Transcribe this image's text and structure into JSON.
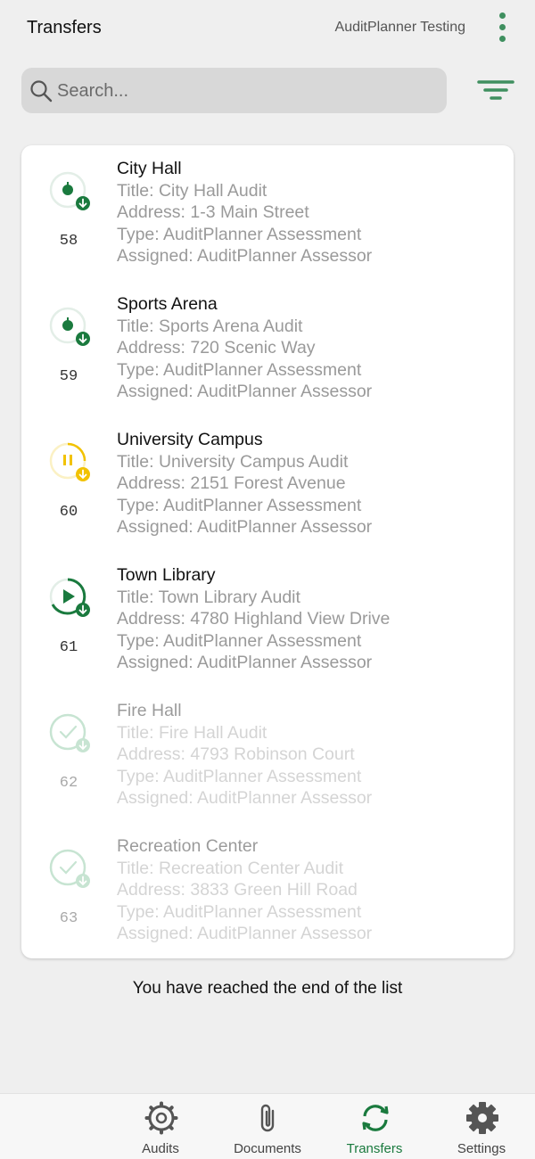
{
  "header": {
    "title": "Transfers",
    "account": "AuditPlanner Testing",
    "menu_icon": "more-vert-icon"
  },
  "search": {
    "placeholder": "Search...",
    "value": "",
    "icon": "search-icon"
  },
  "filter": {
    "icon": "filter-icon"
  },
  "colors": {
    "accent": "#1a7a3e",
    "paused": "#f2c200",
    "completed": "#9fd2b0"
  },
  "transfers": [
    {
      "number": "58",
      "name": "City Hall",
      "title": "Title: City Hall Audit",
      "address": "Address: 1-3 Main Street",
      "type": "Type: AuditPlanner Assessment",
      "assigned": "Assigned: AuditPlanner Assessor",
      "status": "queued"
    },
    {
      "number": "59",
      "name": "Sports Arena",
      "title": "Title: Sports Arena Audit",
      "address": "Address: 720 Scenic Way",
      "type": "Type: AuditPlanner Assessment",
      "assigned": "Assigned: AuditPlanner Assessor",
      "status": "queued"
    },
    {
      "number": "60",
      "name": "University Campus",
      "title": "Title: University Campus Audit",
      "address": "Address: 2151 Forest Avenue",
      "type": "Type: AuditPlanner Assessment",
      "assigned": "Assigned: AuditPlanner Assessor",
      "status": "paused"
    },
    {
      "number": "61",
      "name": "Town Library",
      "title": "Title: Town Library Audit",
      "address": "Address: 4780 Highland View Drive",
      "type": "Type: AuditPlanner Assessment",
      "assigned": "Assigned: AuditPlanner Assessor",
      "status": "in-progress"
    },
    {
      "number": "62",
      "name": "Fire Hall",
      "title": "Title: Fire Hall Audit",
      "address": "Address: 4793 Robinson Court",
      "type": "Type: AuditPlanner Assessment",
      "assigned": "Assigned: AuditPlanner Assessor",
      "status": "completed"
    },
    {
      "number": "63",
      "name": "Recreation Center",
      "title": "Title: Recreation Center Audit",
      "address": "Address: 3833 Green Hill Road",
      "type": "Type: AuditPlanner Assessment",
      "assigned": "Assigned: AuditPlanner Assessor",
      "status": "completed"
    }
  ],
  "end_of_list": "You have reached the end of the list",
  "nav": [
    {
      "label": "Audits",
      "icon": "audits-gear-icon",
      "active": false
    },
    {
      "label": "Documents",
      "icon": "paperclip-icon",
      "active": false
    },
    {
      "label": "Transfers",
      "icon": "sync-icon",
      "active": true
    },
    {
      "label": "Settings",
      "icon": "settings-icon",
      "active": false
    }
  ]
}
